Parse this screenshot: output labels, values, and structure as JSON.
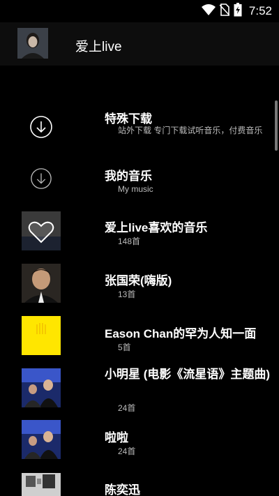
{
  "status_bar": {
    "time": "7:52",
    "icons": [
      "wifi-icon",
      "no-sim-icon",
      "battery-charging-icon"
    ]
  },
  "header": {
    "title": "爱上live",
    "avatar": "avatar"
  },
  "items": [
    {
      "title": "特殊下载",
      "subtitle": "站外下载  专门下载试听音乐，付费音乐",
      "icon": "download-icon"
    },
    {
      "title": "我的音乐",
      "subtitle": "My music",
      "icon": "download-icon"
    },
    {
      "title": "爱上live喜欢的音乐",
      "subtitle": "148首",
      "icon": "heart-icon"
    },
    {
      "title": "张国荣(嗨版)",
      "subtitle": "13首"
    },
    {
      "title": "Eason Chan的罕为人知一面",
      "subtitle": "5首"
    },
    {
      "title": "小明星 (电影《流星语》主题曲)",
      "subtitle": "24首"
    },
    {
      "title": "啦啦",
      "subtitle": "24首"
    },
    {
      "title": "陈奕迅",
      "subtitle": ""
    }
  ]
}
